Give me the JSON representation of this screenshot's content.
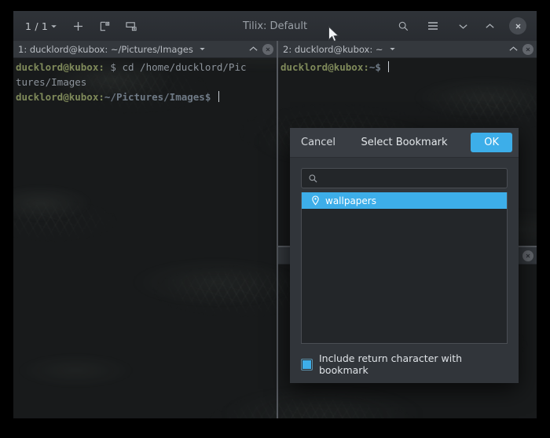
{
  "window": {
    "title": "Tilix: Default",
    "toolbar": {
      "session_count": "1 / 1",
      "session_dropdown_icon": "chevron-down-icon",
      "new_session_icon": "plus-icon",
      "split_right_icon": "add-terminal-right-icon",
      "split_down_icon": "add-terminal-down-icon"
    },
    "controls": {
      "search_icon": "search-icon",
      "menu_icon": "hamburger-menu-icon",
      "collapse_icon": "chevron-down-icon",
      "expand_icon": "chevron-up-icon",
      "close_icon": "close-icon"
    }
  },
  "panes": [
    {
      "title": "1: ducklord@kubox: ~/Pictures/Images",
      "caret_icon": "chevron-down-icon",
      "maximize_icon": "chevron-up-icon",
      "close_icon": "close-icon",
      "lines": [
        {
          "prompt": "ducklord@kubox:",
          "path": "",
          "sigil": " $ ",
          "command": "cd /home/ducklord/Pic"
        },
        {
          "prompt": "",
          "path": "",
          "sigil": "",
          "command": "tures/Images"
        },
        {
          "prompt": "ducklord@kubox:",
          "path": "~/Pictures/Images",
          "sigil": "$ ",
          "command": ""
        }
      ]
    },
    {
      "title": "2: ducklord@kubox: ~",
      "caret_icon": "chevron-down-icon",
      "maximize_icon": "chevron-up-icon",
      "close_icon": "close-icon",
      "lines": [
        {
          "prompt": "ducklord@kubox:",
          "path": "~",
          "sigil": "$ ",
          "command": ""
        }
      ]
    },
    {
      "title": "",
      "caret_icon": "chevron-down-icon",
      "maximize_icon": "chevron-up-icon",
      "close_icon": "close-icon",
      "lines": []
    }
  ],
  "dialog": {
    "cancel_label": "Cancel",
    "title": "Select Bookmark",
    "ok_label": "OK",
    "search": {
      "icon": "search-icon",
      "value": "",
      "placeholder": ""
    },
    "bookmarks": [
      {
        "icon": "location-pin-icon",
        "label": "wallpapers",
        "selected": true
      }
    ],
    "checkbox": {
      "label": "Include return character with bookmark",
      "checked": true
    }
  },
  "colors": {
    "accent": "#3daee9",
    "window_bg": "#2b2e33",
    "dialog_bg": "#31353a",
    "pane_title_bg": "#34383d",
    "terminal_bg": "#181a1b"
  }
}
